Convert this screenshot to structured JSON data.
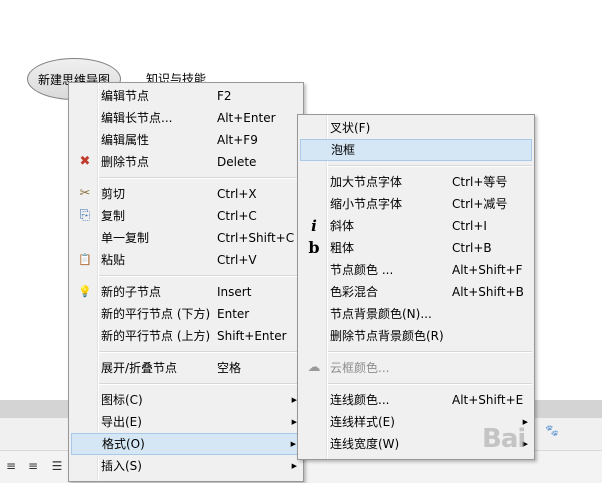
{
  "mindmap": {
    "root_label": "新建思维导图",
    "child_label": "知识与技能"
  },
  "context_menu": {
    "items": [
      {
        "label": "编辑节点",
        "shortcut": "F2"
      },
      {
        "label": "编辑长节点...",
        "shortcut": "Alt+Enter"
      },
      {
        "label": "编辑属性",
        "shortcut": "Alt+F9"
      },
      {
        "label": "删除节点",
        "shortcut": "Delete",
        "icon": "delete-icon"
      },
      {
        "label": "剪切",
        "shortcut": "Ctrl+X",
        "icon": "scissors-icon"
      },
      {
        "label": "复制",
        "shortcut": "Ctrl+C",
        "icon": "copy-icon"
      },
      {
        "label": "单一复制",
        "shortcut": "Ctrl+Shift+C"
      },
      {
        "label": "粘贴",
        "shortcut": "Ctrl+V",
        "icon": "paste-icon"
      },
      {
        "label": "新的子节点",
        "shortcut": "Insert",
        "icon": "lightbulb-icon"
      },
      {
        "label": "新的平行节点 (下方)",
        "shortcut": "Enter"
      },
      {
        "label": "新的平行节点 (上方)",
        "shortcut": "Shift+Enter"
      },
      {
        "label": "展开/折叠节点",
        "shortcut": "空格"
      },
      {
        "label": "图标(C)"
      },
      {
        "label": "导出(E)"
      },
      {
        "label": "格式(O)"
      },
      {
        "label": "插入(S)"
      }
    ]
  },
  "format_submenu": {
    "items": [
      {
        "label": "叉状(F)"
      },
      {
        "label": "泡框"
      },
      {
        "label": "加大节点字体",
        "shortcut": "Ctrl+等号"
      },
      {
        "label": "缩小节点字体",
        "shortcut": "Ctrl+减号"
      },
      {
        "label": "斜体",
        "shortcut": "Ctrl+I",
        "icon": "italic-icon"
      },
      {
        "label": "粗体",
        "shortcut": "Ctrl+B",
        "icon": "bold-icon"
      },
      {
        "label": "节点颜色 ...",
        "shortcut": "Alt+Shift+F"
      },
      {
        "label": "色彩混合",
        "shortcut": "Alt+Shift+B"
      },
      {
        "label": "节点背景颜色(N)..."
      },
      {
        "label": "删除节点背景颜色(R)"
      },
      {
        "label": "云框颜色...",
        "icon": "cloud-icon",
        "disabled": true
      },
      {
        "label": "连线颜色...",
        "shortcut": "Alt+Shift+E"
      },
      {
        "label": "连线样式(E)"
      },
      {
        "label": "连线宽度(W)"
      }
    ]
  },
  "icons": {
    "delete": "✖",
    "scissors": "✂",
    "copy": "⎘",
    "paste": "📋",
    "lightbulb": "💡",
    "italic": "i",
    "bold": "b",
    "cloud": "☁",
    "arrow": "▶"
  },
  "watermark": {
    "text": "Bai",
    "paw": "🐾"
  }
}
